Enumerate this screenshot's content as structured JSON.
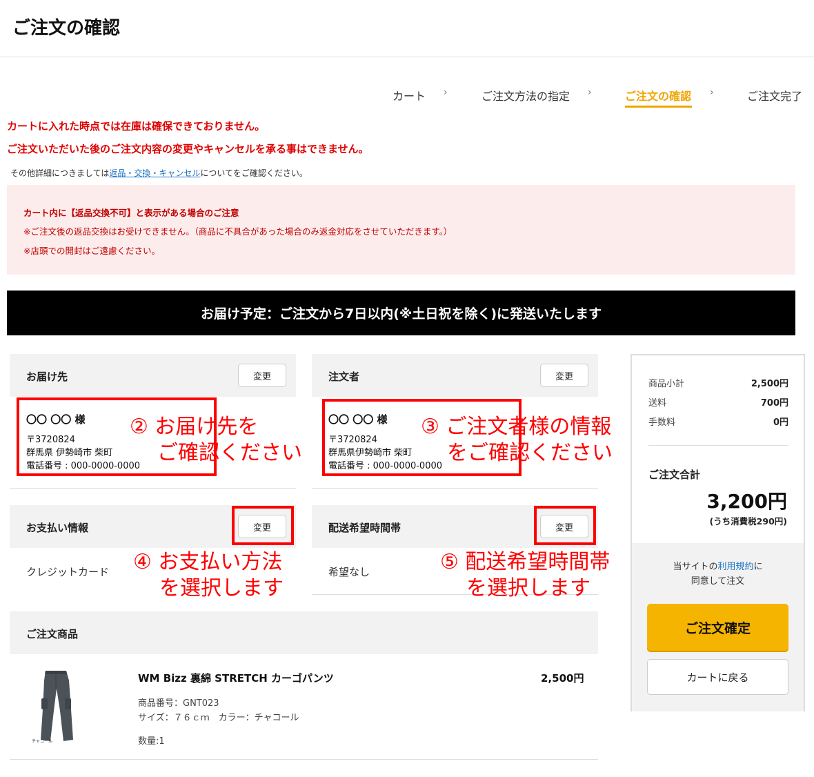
{
  "page": {
    "title": "ご注文の確認"
  },
  "steps": [
    {
      "label": "カート"
    },
    {
      "label": "ご注文方法の指定"
    },
    {
      "label": "ご注文の確認"
    },
    {
      "label": "ご注文完了"
    }
  ],
  "steps_chevron": "›",
  "warnings": [
    "カートに入れた時点では在庫は確保できておりません。",
    "ご注文いただいた後のご注文内容の変更やキャンセルを承る事はできません。"
  ],
  "note": {
    "prefix": "その他詳細につきましては",
    "link": "返品・交換・キャンセル",
    "suffix": "についてをご確認ください。"
  },
  "notice": {
    "heading": "カート内に【返品交換不可】と表示がある場合のご注意",
    "lines": [
      "※ご注文後の返品交換はお受けできません。（商品に不具合があった場合のみ返金対応をさせていただきます。）",
      "※店頭での開封はご遠慮ください。"
    ]
  },
  "shipping_banner": "お届け予定：ご注文から7日以内(※土日祝を除く)に発送いたします",
  "change_label": "変更",
  "delivery": {
    "label": "お届け先",
    "name": "〇〇 〇〇 様",
    "postal": "〒3720824",
    "address": "群馬県 伊勢崎市 柴町",
    "phone": "電話番号 : 000-0000-0000"
  },
  "orderer": {
    "label": "注文者",
    "name": "〇〇 〇〇 様",
    "postal": "〒3720824",
    "address": "群馬県伊勢崎市 柴町",
    "phone": "電話番号 : 000-0000-0000"
  },
  "payment": {
    "label": "お支払い情報",
    "value": "クレジットカード"
  },
  "delivery_time": {
    "label": "配送希望時間帯",
    "value": "希望なし"
  },
  "annotations": {
    "a2": [
      "② お届け先を",
      "ご確認ください"
    ],
    "a3": [
      "③ ご注文者様の情報",
      "をご確認ください"
    ],
    "a4": [
      "④ お支払い方法",
      "を選択します"
    ],
    "a5": [
      "⑤ 配送希望時間帯",
      "を選択します"
    ]
  },
  "products_section": {
    "label": "ご注文商品"
  },
  "product": {
    "name": "WM Bizz 裏綿 STRETCH カーゴパンツ",
    "price": "2,500円",
    "code": "商品番号：GNT023",
    "size_color": "サイズ：７６ｃｍ　カラー：チャコール",
    "qty": "数量:1",
    "image_caption": "チャコール"
  },
  "summary": {
    "rows": [
      {
        "label": "商品小計",
        "value": "2,500円"
      },
      {
        "label": "送料",
        "value": "700円"
      },
      {
        "label": "手数料",
        "value": "0円"
      }
    ],
    "total_label": "ご注文合計",
    "total_value": "3,200円",
    "tax": "(うち消費税290円)",
    "agree_prefix": "当サイトの",
    "agree_link": "利用規約",
    "agree_suffix": "に",
    "agree_line2": "同意して注文",
    "confirm": "ご注文確定",
    "back": "カートに戻る"
  },
  "colors": {
    "accent": "#f0a500",
    "warning": "#e00000",
    "annotation": "#ff0000",
    "confirm": "#f5b400"
  }
}
